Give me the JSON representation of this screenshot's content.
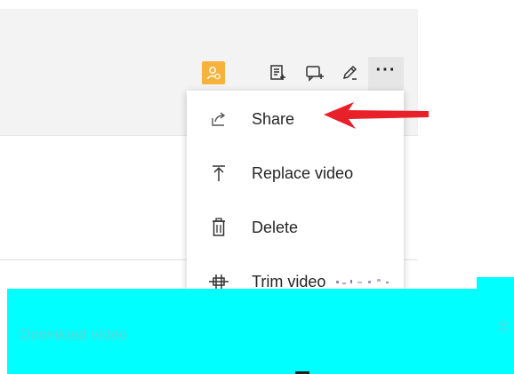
{
  "toolbar": {
    "avatar_icon": "person-icon",
    "avatar_color": "#f6b23a",
    "icons": [
      "add-note-icon",
      "add-comment-icon",
      "pencil-icon"
    ],
    "more_label": "···"
  },
  "menu": {
    "items": [
      {
        "label": "Share",
        "icon": "share-icon"
      },
      {
        "label": "Replace video",
        "icon": "upload-icon"
      },
      {
        "label": "Delete",
        "icon": "trash-icon"
      },
      {
        "label": "Trim video",
        "icon": "trim-icon"
      }
    ]
  },
  "overlay": {
    "download_label": "Download video",
    "color": "#00ffff"
  },
  "annotation": {
    "arrow_color": "#e8202a"
  }
}
